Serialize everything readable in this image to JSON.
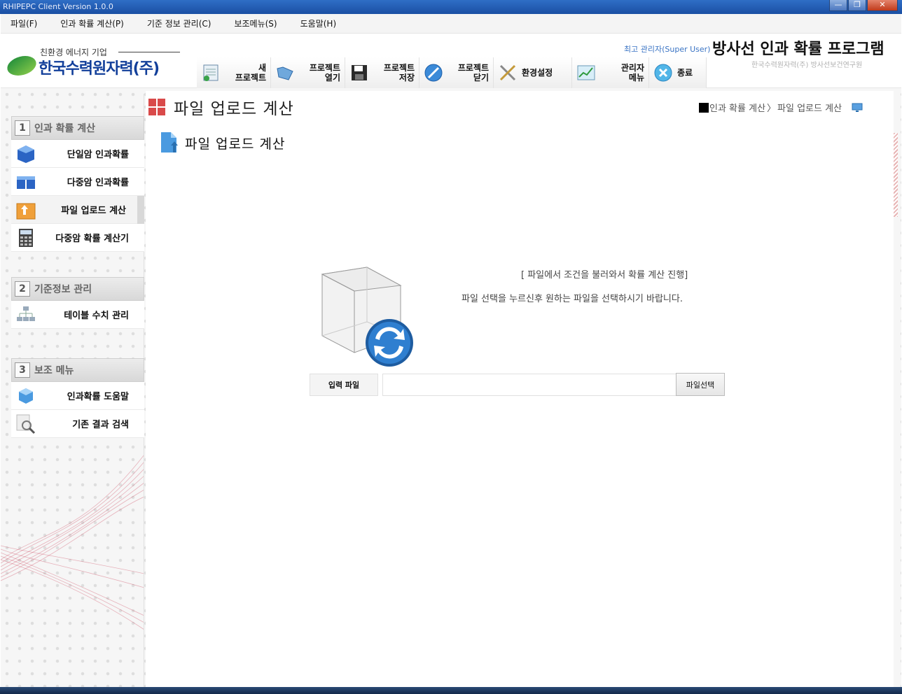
{
  "window": {
    "title": "RHIPEPC Client Version 1.0.0"
  },
  "menu": [
    {
      "label": "파일(F)"
    },
    {
      "label": "인과 확률 계산(P)"
    },
    {
      "label": "기준 정보 관리(C)"
    },
    {
      "label": "보조메뉴(S)"
    },
    {
      "label": "도움말(H)"
    }
  ],
  "header": {
    "tagline": "친환경 에너지 기업",
    "company": "한국수력원자력(주)",
    "user": "최고 관리자(Super User)",
    "app_title": "방사선 인과 확률 프로그램",
    "app_subtitle": "한국수력원자력(주) 방사선보건연구원"
  },
  "toolbar": [
    {
      "label": "새\n프로젝트",
      "icon": "new-project-icon"
    },
    {
      "label": "프로젝트\n열기",
      "icon": "open-project-icon"
    },
    {
      "label": "프로젝트\n저장",
      "icon": "save-icon"
    },
    {
      "label": "프로젝트\n닫기",
      "icon": "close-project-icon"
    },
    {
      "label": "환경설정",
      "icon": "settings-icon"
    },
    {
      "label": "관리자\n메뉴",
      "icon": "admin-chart-icon"
    },
    {
      "label": "종료",
      "icon": "exit-icon"
    }
  ],
  "sidebar": {
    "sections": [
      {
        "num": "1",
        "title": "인과 확률 계산",
        "items": [
          {
            "label": "단일암 인과확률",
            "icon": "single-cube-icon"
          },
          {
            "label": "다중암 인과확률",
            "icon": "multi-cube-icon"
          },
          {
            "label": "파일 업로드 계산",
            "icon": "upload-box-icon",
            "active": true
          },
          {
            "label": "다중암 확률 계산기",
            "icon": "calculator-icon"
          }
        ]
      },
      {
        "num": "2",
        "title": "기준정보 관리",
        "items": [
          {
            "label": "테이블 수치 관리",
            "icon": "table-tree-icon"
          }
        ]
      },
      {
        "num": "3",
        "title": "보조 메뉴",
        "items": [
          {
            "label": "인과확률 도움말",
            "icon": "help-cube-icon"
          },
          {
            "label": "기존 결과 검색",
            "icon": "search-magnifier-icon"
          }
        ]
      }
    ]
  },
  "page": {
    "title": "파일 업로드 계산",
    "breadcrumb": [
      "인과 확률 계산",
      "파일 업로드 계산"
    ],
    "subtitle": "파일 업로드 계산",
    "desc1": "[ 파일에서 조건을 불러와서 확률 계산 진행]",
    "desc2": "파일 선택을 누르신후 원하는 파일을 선택하시기 바랍니다.",
    "input_label": "입력 파일",
    "input_value": "",
    "file_button": "파일선택"
  }
}
